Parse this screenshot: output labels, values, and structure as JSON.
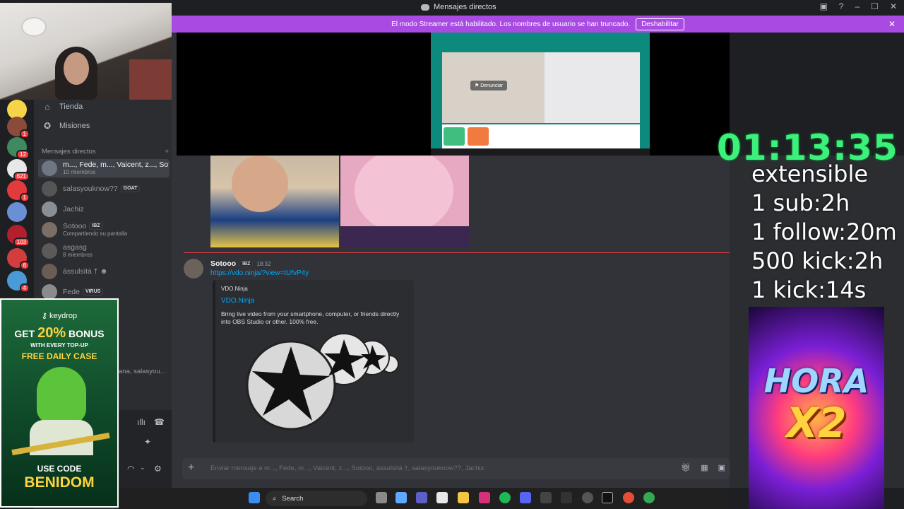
{
  "window": {
    "title": "Mensajes directos",
    "controls": [
      "–",
      "☐",
      "✕"
    ]
  },
  "banner": {
    "text": "El modo Streamer está habilitado. Los nombres de usuario se han truncado.",
    "button": "Deshabilitar"
  },
  "rail": {
    "badges": [
      "1",
      "12",
      "621",
      "1",
      "103",
      "6",
      "4"
    ]
  },
  "nav": {
    "store": "Tienda",
    "quests": "Misiones"
  },
  "dm_section": {
    "title": "Mensajes directos",
    "add": "+"
  },
  "dms": [
    {
      "name": "m..., Fede, m..., Vaicent, z..., Sot...",
      "sub": "10 miembros",
      "tag": ""
    },
    {
      "name": "salasyouknow??",
      "sub": "",
      "tag": "GOAT"
    },
    {
      "name": "Jachiz",
      "sub": "",
      "tag": ""
    },
    {
      "name": "Sotooo",
      "sub": "Compartiendo su pantalla",
      "tag": "IBZ"
    },
    {
      "name": "asgasg",
      "sub": "8 miembros",
      "tag": ""
    },
    {
      "name": "ȧssulsitȧ † ☻",
      "sub": "",
      "tag": ""
    },
    {
      "name": "Fede",
      "sub": "",
      "tag": "VIRUS"
    }
  ],
  "screenshare": {
    "report": "Denunciar"
  },
  "message": {
    "author": "Sotooo",
    "tag": "IBZ",
    "time": "18:32",
    "link": "https://vdo.ninja/?view=tUfvP4y",
    "embed": {
      "provider": "VDO.Ninja",
      "title": "VDO.Ninja",
      "description": "Bring live video from your smartphone, computer, or friends directly into OBS Studio or other. 100% free."
    }
  },
  "composer": {
    "placeholder": "Enviar mensaje a m..., Fede, m..., Vaicent, z..., Sotooo, ȧssulsitȧ †, salasyouknow??, Jachiz"
  },
  "voice": {
    "group_fragment": "ana, salasyou..."
  },
  "overlay": {
    "timer": "01:13:35",
    "lines": [
      "extensible",
      "1 sub:2h",
      "1 follow:20m",
      "500 kick:2h",
      "1 kick:14s"
    ],
    "promo_word1": "HORA",
    "promo_word2": "X2"
  },
  "keydrop": {
    "logo": "keydrop",
    "line1_a": "GET",
    "line1_b": "20%",
    "line1_c": "BONUS",
    "line2": "WITH EVERY TOP-UP",
    "line3": "FREE DAILY CASE",
    "line4": "USE CODE",
    "code": "BENIDOM"
  },
  "taskbar": {
    "search": "Search"
  },
  "colors": {
    "banner": "#a94be3",
    "timer": "#3cf07c",
    "link": "#00a8fc",
    "background": "#313338"
  }
}
